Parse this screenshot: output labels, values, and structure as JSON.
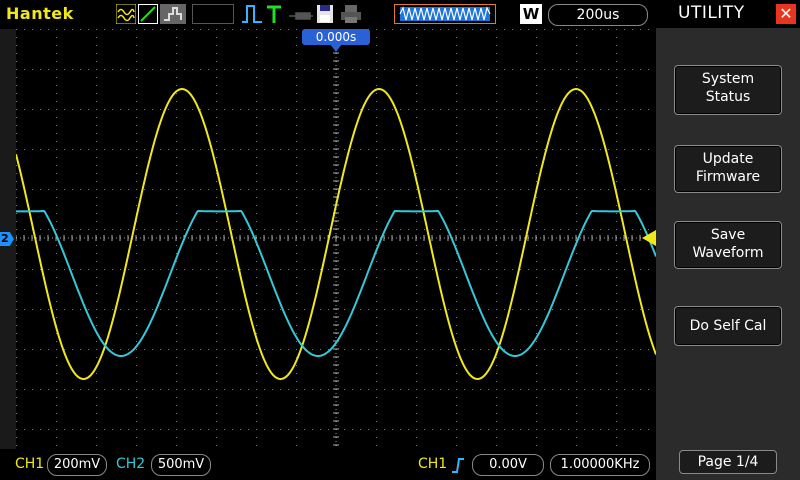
{
  "brand": "Hantek",
  "toolbar": {
    "icons": [
      "wave-mode-icon",
      "line-mode-icon",
      "persist-icon",
      "blank-icon",
      "pulse-trigger-icon",
      "trigger-t-icon",
      "probe-icon",
      "save-disk-icon",
      "printer-icon",
      "memory-depth-icon"
    ],
    "w_label": "W",
    "timebase": "200us"
  },
  "trigger_offset": "0.000s",
  "ch2_marker": "2",
  "colors": {
    "ch1": "#f0e81c",
    "ch2": "#35c8d8",
    "marker": "#1e90ff"
  },
  "bottom": {
    "ch1_label": "CH1",
    "ch1_scale": "200mV",
    "ch2_label": "CH2",
    "ch2_scale": "500mV",
    "trig_label": "CH1",
    "trig_level": "0.00V",
    "frequency": "1.00000KHz"
  },
  "utility_menu": {
    "title": "UTILITY",
    "close_icon": "close-icon",
    "buttons": [
      {
        "line1": "System",
        "line2": "Status"
      },
      {
        "line1": "Update",
        "line2": "Firmware"
      },
      {
        "line1": "Save",
        "line2": "Waveform"
      },
      {
        "line1": "Do Self Cal",
        "line2": ""
      }
    ],
    "page": "Page 1/4"
  }
}
